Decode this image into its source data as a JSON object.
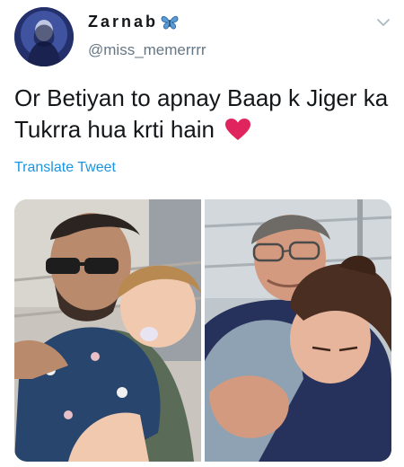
{
  "tweet": {
    "display_name": "Zarnab",
    "handle": "@miss_memerrrr",
    "text": "Or Betiyan to apnay Baap k Jiger ka Tukrra hua krti hain",
    "translate_label": "Translate Tweet"
  },
  "icons": {
    "name_emoji": "butterfly-icon",
    "text_emoji": "red-heart-icon",
    "menu": "chevron-down-icon"
  },
  "colors": {
    "link": "#1b95e0",
    "secondary_text": "#657786",
    "heart": "#e0245e"
  }
}
